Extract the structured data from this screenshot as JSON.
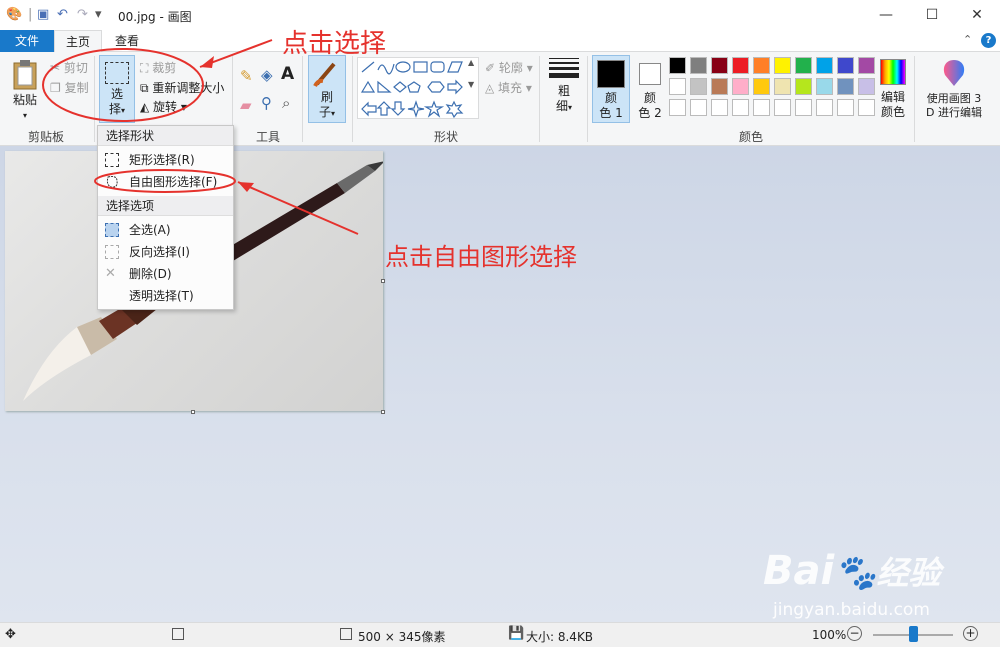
{
  "window": {
    "title": "00.jpg - 画图",
    "minimize": "—",
    "maximize": "☐",
    "close": "✕"
  },
  "quick_access": {
    "undo": "↶",
    "redo": "↷",
    "dropdown": "▾"
  },
  "tabs": [
    {
      "label": "文件"
    },
    {
      "label": "主页"
    },
    {
      "label": "查看"
    }
  ],
  "ribbon": {
    "clipboard": {
      "paste": "粘贴",
      "cut": "剪切",
      "copy": "复制",
      "group": "剪贴板"
    },
    "image": {
      "select_line1": "选",
      "select_line2": "择",
      "crop": "裁剪",
      "resize": "重新调整大小",
      "rotate": "旋转"
    },
    "tools": {
      "group": "工具"
    },
    "brushes": {
      "line1": "刷",
      "line2": "子"
    },
    "shapes": {
      "outline": "轮廓",
      "fill": "填充",
      "group": "形状"
    },
    "size": {
      "line1": "粗",
      "line2": "细"
    },
    "colors": {
      "color1_l1": "颜",
      "color1_l2": "色 1",
      "color2_l1": "颜",
      "color2_l2": "色 2",
      "edit_l1": "编辑",
      "edit_l2": "颜色",
      "group": "颜色",
      "palette_row1": [
        "#000000",
        "#7f7f7f",
        "#880015",
        "#ed1c24",
        "#ff7f27",
        "#fff200",
        "#22b14c",
        "#00a2e8",
        "#3f48cc",
        "#a349a4"
      ],
      "palette_row2": [
        "#ffffff",
        "#c3c3c3",
        "#b97a57",
        "#ffaec9",
        "#ffc90e",
        "#efe4b0",
        "#b5e61d",
        "#99d9ea",
        "#7092be",
        "#c8bfe7"
      ],
      "current1": "#000000",
      "current2": "#ffffff"
    },
    "paint3d": {
      "line1": "使用画图 3",
      "line2": "D 进行编辑"
    }
  },
  "select_menu": {
    "shape_header": "选择形状",
    "rect": "矩形选择(R)",
    "free": "自由图形选择(F)",
    "options_header": "选择选项",
    "select_all": "全选(A)",
    "invert": "反向选择(I)",
    "delete": "删除(D)",
    "transparent": "透明选择(T)"
  },
  "annotations": {
    "click_select": "点击选择",
    "click_free": "点击自由图形选择"
  },
  "status": {
    "dimensions": "500 × 345像素",
    "size": "大小: 8.4KB",
    "zoom": "100%",
    "zoom_level": 0.5
  },
  "watermark": {
    "brand": "Bai",
    "brand_cn": "经验",
    "url": "jingyan.baidu.com"
  }
}
